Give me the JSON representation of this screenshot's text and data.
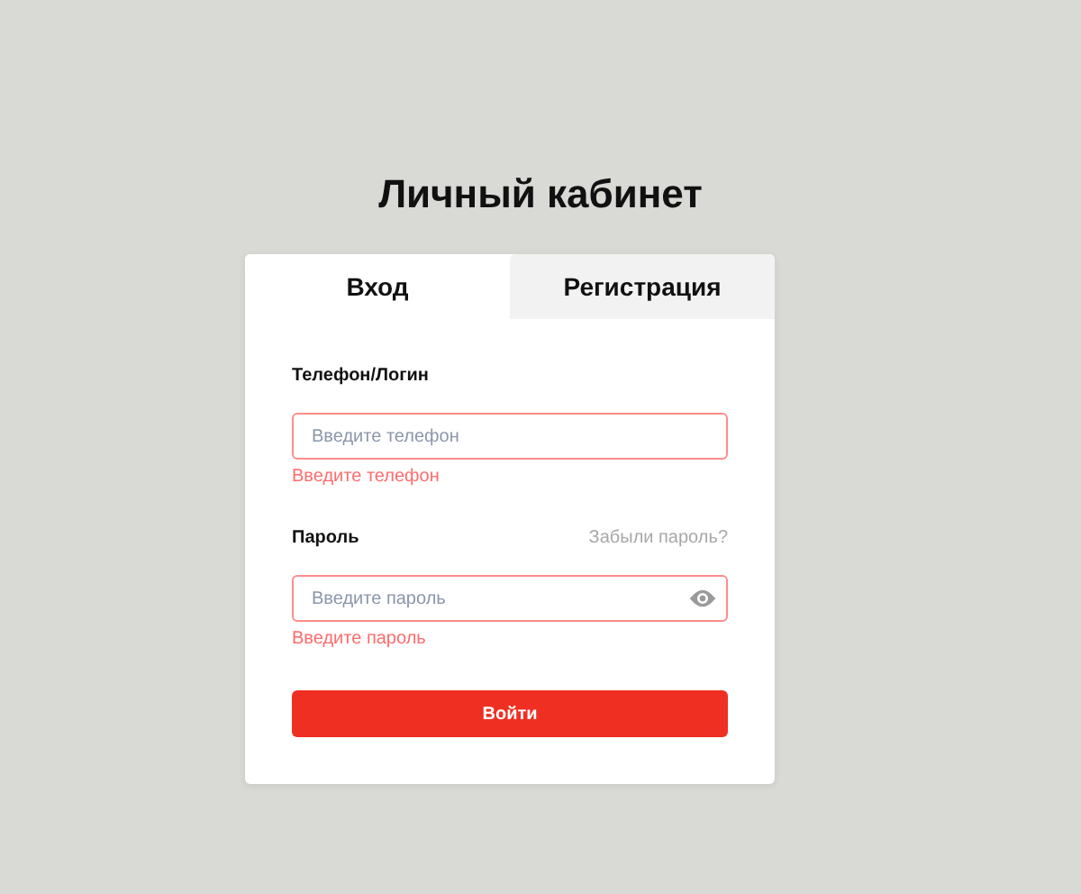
{
  "title": "Личный кабинет",
  "tabs": [
    {
      "label": "Вход",
      "selected": true
    },
    {
      "label": "Регистрация",
      "selected": false
    }
  ],
  "fields": [
    {
      "kind": "text",
      "label": "Телефон/Логин",
      "placeholder": "Введите телефон",
      "invalid": true,
      "error": "Введите телефон"
    },
    {
      "kind": "password",
      "label": "Пароль",
      "link": "Забыли пароль?",
      "placeholder": "Введите пароль",
      "invalid": true,
      "error": "Введите пароль"
    }
  ],
  "submit": "Войти"
}
